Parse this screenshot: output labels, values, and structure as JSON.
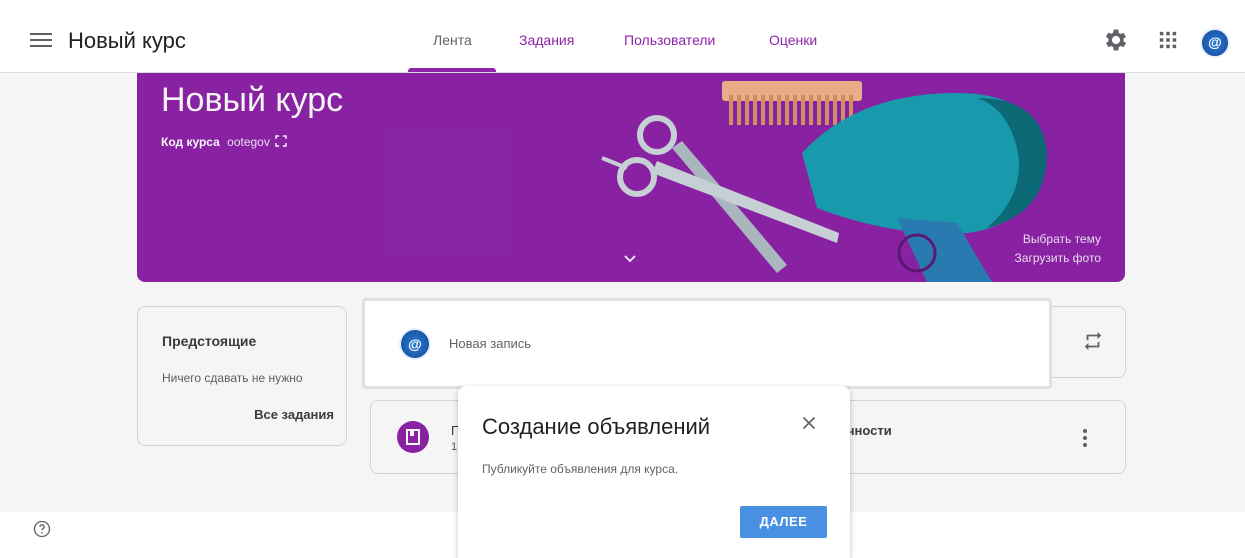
{
  "header": {
    "course_title": "Новый курс",
    "tabs": [
      {
        "label": "Лента",
        "active": true
      },
      {
        "label": "Задания",
        "active": false
      },
      {
        "label": "Пользователи",
        "active": false
      },
      {
        "label": "Оценки",
        "active": false
      }
    ],
    "icons": [
      "menu-icon",
      "settings-gear-icon",
      "apps-grid-icon",
      "account-avatar-icon"
    ]
  },
  "banner": {
    "title": "Новый курс",
    "code_label": "Код курса",
    "code_value": "ootegov",
    "select_theme": "Выбрать тему",
    "upload_photo": "Загрузить фото"
  },
  "upcoming": {
    "heading": "Предстоящие",
    "empty_text": "Ничего сдавать не нужно",
    "all_tasks_link": "Все задания"
  },
  "stream": {
    "new_post_placeholder": "Новая запись",
    "post_title_fragment": "П",
    "post_sub_fragment": "1",
    "post_right_fragment": "ичности"
  },
  "dialog": {
    "title": "Создание объявлений",
    "body": "Публикуйте объявления для курса.",
    "next_button": "ДАЛЕЕ"
  },
  "colors": {
    "accent": "#8e24aa",
    "button_blue": "#4a90e2",
    "text_primary": "#202124"
  }
}
